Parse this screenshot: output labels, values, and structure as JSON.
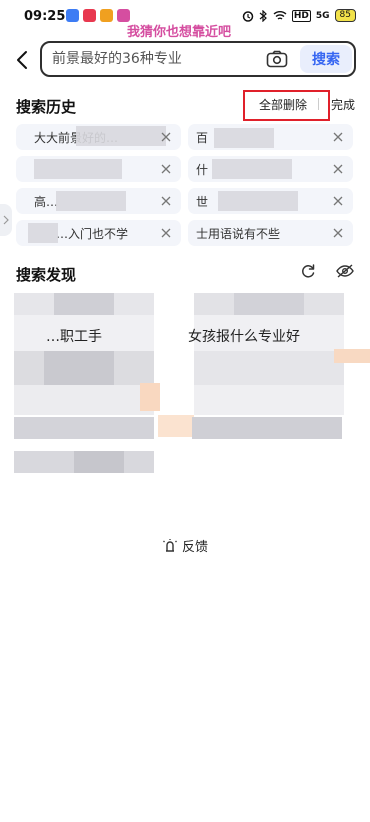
{
  "status_bar": {
    "time": "09:25",
    "watermark": "我猜你也想靠近吧",
    "battery": "85",
    "network": "HD",
    "signal": "5G"
  },
  "search": {
    "placeholder": "前景最好的36种专业",
    "button_label": "搜索"
  },
  "history": {
    "title": "搜索历史",
    "delete_all_label": "全部删除",
    "done_label": "完成",
    "items": [
      {
        "label": "大大前景好的…"
      },
      {
        "label": "百"
      },
      {
        "label": ""
      },
      {
        "label": "什"
      },
      {
        "label": "高…"
      },
      {
        "label": "世"
      },
      {
        "label": "…入门也不学"
      },
      {
        "label": "士用语说有不些"
      }
    ]
  },
  "discovery": {
    "title": "搜索发现",
    "left_item": "…职工手",
    "right_item": "女孩报什么专业好"
  },
  "feedback": {
    "label": "反馈"
  },
  "colors": {
    "accent": "#3565f2",
    "highlight": "#e0202a",
    "watermark": "#d54ea0"
  }
}
